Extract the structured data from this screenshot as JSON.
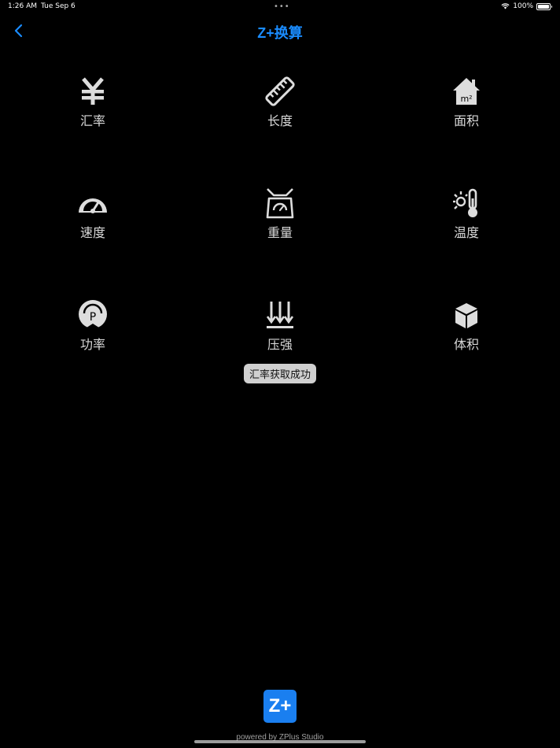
{
  "status": {
    "time": "1:26 AM",
    "date": "Tue Sep 6",
    "battery": "100%",
    "battery_level": 1.0
  },
  "nav": {
    "back_icon": "chevron-left-icon",
    "title": "Z+换算",
    "accent_color": "#1a8cff"
  },
  "categories": [
    {
      "label": "汇率",
      "icon": "yen-icon"
    },
    {
      "label": "长度",
      "icon": "ruler-icon"
    },
    {
      "label": "面积",
      "icon": "house-area-icon"
    },
    {
      "label": "速度",
      "icon": "speedometer-icon"
    },
    {
      "label": "重量",
      "icon": "scale-icon"
    },
    {
      "label": "温度",
      "icon": "thermometer-icon"
    },
    {
      "label": "功率",
      "icon": "power-pin-icon"
    },
    {
      "label": "压强",
      "icon": "pressure-arrows-icon"
    },
    {
      "label": "体积",
      "icon": "cube-icon"
    }
  ],
  "toast": {
    "message": "汇率获取成功"
  },
  "footer": {
    "logo": "Z+",
    "text": "powered by ZPlus Studio"
  }
}
